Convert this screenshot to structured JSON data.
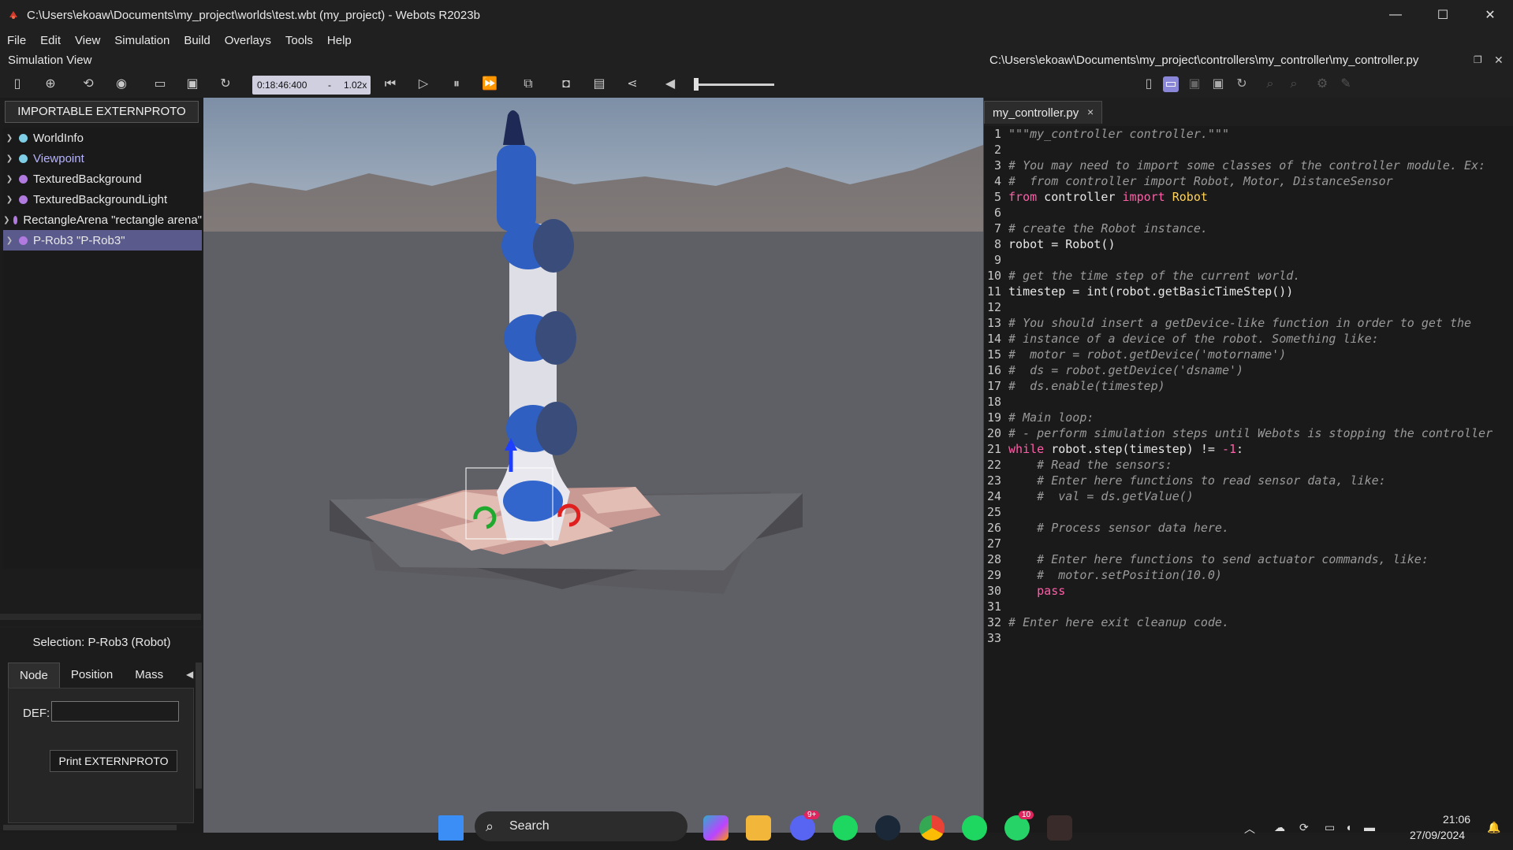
{
  "window": {
    "title": "C:\\Users\\ekoaw\\Documents\\my_project\\worlds\\test.wbt (my_project) - Webots R2023b",
    "min": "—",
    "max": "☐",
    "close": "✕"
  },
  "menu": [
    "File",
    "Edit",
    "View",
    "Simulation",
    "Build",
    "Overlays",
    "Tools",
    "Help"
  ],
  "sim_view": {
    "label": "Simulation View"
  },
  "toolbar": {
    "time": "0:18:46:400",
    "dash": "-",
    "speed": "1.02x"
  },
  "scene_tree": {
    "extern_button": "IMPORTABLE EXTERNPROTO",
    "items": [
      {
        "label": "WorldInfo",
        "color": "#7ecfe6"
      },
      {
        "label": "Viewpoint",
        "color": "#7ecfe6"
      },
      {
        "label": "TexturedBackground",
        "color": "#b07adf"
      },
      {
        "label": "TexturedBackgroundLight",
        "color": "#b07adf"
      },
      {
        "label": "RectangleArena \"rectangle arena\"",
        "color": "#b07adf"
      },
      {
        "label": "P-Rob3 \"P-Rob3\"",
        "color": "#b07adf"
      }
    ]
  },
  "selection": {
    "title": "Selection: P-Rob3 (Robot)",
    "tabs": [
      "Node",
      "Position",
      "Mass"
    ],
    "def_label": "DEF:",
    "def_value": "",
    "print_button": "Print EXTERNPROTO"
  },
  "editor": {
    "path": "C:\\Users\\ekoaw\\Documents\\my_project\\controllers\\my_controller\\my_controller.py",
    "tab_label": "my_controller.py",
    "tab_close": "×",
    "lines": [
      {
        "n": "1",
        "t": "\"\"\"my_controller controller.\"\"\"",
        "k": "comment"
      },
      {
        "n": "2",
        "t": "",
        "k": ""
      },
      {
        "n": "3",
        "t": "# You may need to import some classes of the controller module. Ex:",
        "k": "comment"
      },
      {
        "n": "4",
        "t": "#  from controller import Robot, Motor, DistanceSensor",
        "k": "comment"
      },
      {
        "n": "5",
        "t": "from controller import Robot",
        "k": "import"
      },
      {
        "n": "6",
        "t": "",
        "k": ""
      },
      {
        "n": "7",
        "t": "# create the Robot instance.",
        "k": "comment"
      },
      {
        "n": "8",
        "t": "robot = Robot()",
        "k": ""
      },
      {
        "n": "9",
        "t": "",
        "k": ""
      },
      {
        "n": "10",
        "t": "# get the time step of the current world.",
        "k": "comment"
      },
      {
        "n": "11",
        "t": "timestep = int(robot.getBasicTimeStep())",
        "k": ""
      },
      {
        "n": "12",
        "t": "",
        "k": ""
      },
      {
        "n": "13",
        "t": "# You should insert a getDevice-like function in order to get the",
        "k": "comment"
      },
      {
        "n": "14",
        "t": "# instance of a device of the robot. Something like:",
        "k": "comment"
      },
      {
        "n": "15",
        "t": "#  motor = robot.getDevice('motorname')",
        "k": "comment"
      },
      {
        "n": "16",
        "t": "#  ds = robot.getDevice('dsname')",
        "k": "comment"
      },
      {
        "n": "17",
        "t": "#  ds.enable(timestep)",
        "k": "comment"
      },
      {
        "n": "18",
        "t": "",
        "k": ""
      },
      {
        "n": "19",
        "t": "# Main loop:",
        "k": "comment"
      },
      {
        "n": "20",
        "t": "# - perform simulation steps until Webots is stopping the controller",
        "k": "comment"
      },
      {
        "n": "21",
        "t": "while robot.step(timestep) != -1:",
        "k": "while"
      },
      {
        "n": "22",
        "t": "    # Read the sensors:",
        "k": "comment"
      },
      {
        "n": "23",
        "t": "    # Enter here functions to read sensor data, like:",
        "k": "comment"
      },
      {
        "n": "24",
        "t": "    #  val = ds.getValue()",
        "k": "comment"
      },
      {
        "n": "25",
        "t": "",
        "k": ""
      },
      {
        "n": "26",
        "t": "    # Process sensor data here.",
        "k": "comment"
      },
      {
        "n": "27",
        "t": "",
        "k": ""
      },
      {
        "n": "28",
        "t": "    # Enter here functions to send actuator commands, like:",
        "k": "comment"
      },
      {
        "n": "29",
        "t": "    #  motor.setPosition(10.0)",
        "k": "comment"
      },
      {
        "n": "30",
        "t": "    pass",
        "k": "kw"
      },
      {
        "n": "31",
        "t": "",
        "k": ""
      },
      {
        "n": "32",
        "t": "# Enter here exit cleanup code.",
        "k": "comment"
      },
      {
        "n": "33",
        "t": "",
        "k": ""
      }
    ]
  },
  "taskbar": {
    "search_label": "Search",
    "discord_badge": "9+",
    "whatsapp_badge": "10",
    "time": "21:06",
    "date": "27/09/2024"
  }
}
